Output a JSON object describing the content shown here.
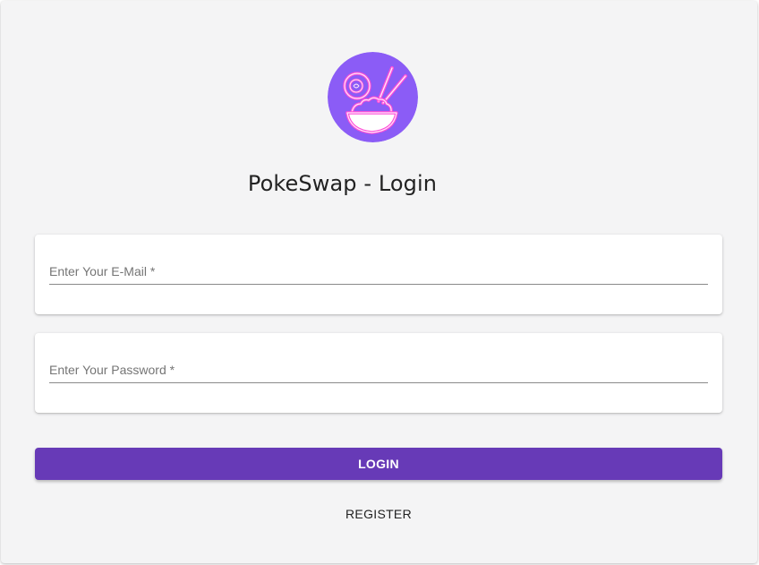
{
  "app": {
    "title": "PokeSwap - Login"
  },
  "logo": {
    "icon": "poke-bowl-icon",
    "background_color": "#8b5cf6",
    "accent_color": "#ff4fd8"
  },
  "form": {
    "email": {
      "placeholder": "Enter Your E-Mail *",
      "value": ""
    },
    "password": {
      "placeholder": "Enter Your Password *",
      "value": ""
    },
    "login_label": "LOGIN",
    "register_label": "REGISTER"
  },
  "colors": {
    "primary": "#673ab7",
    "background": "#f4f4f5"
  }
}
